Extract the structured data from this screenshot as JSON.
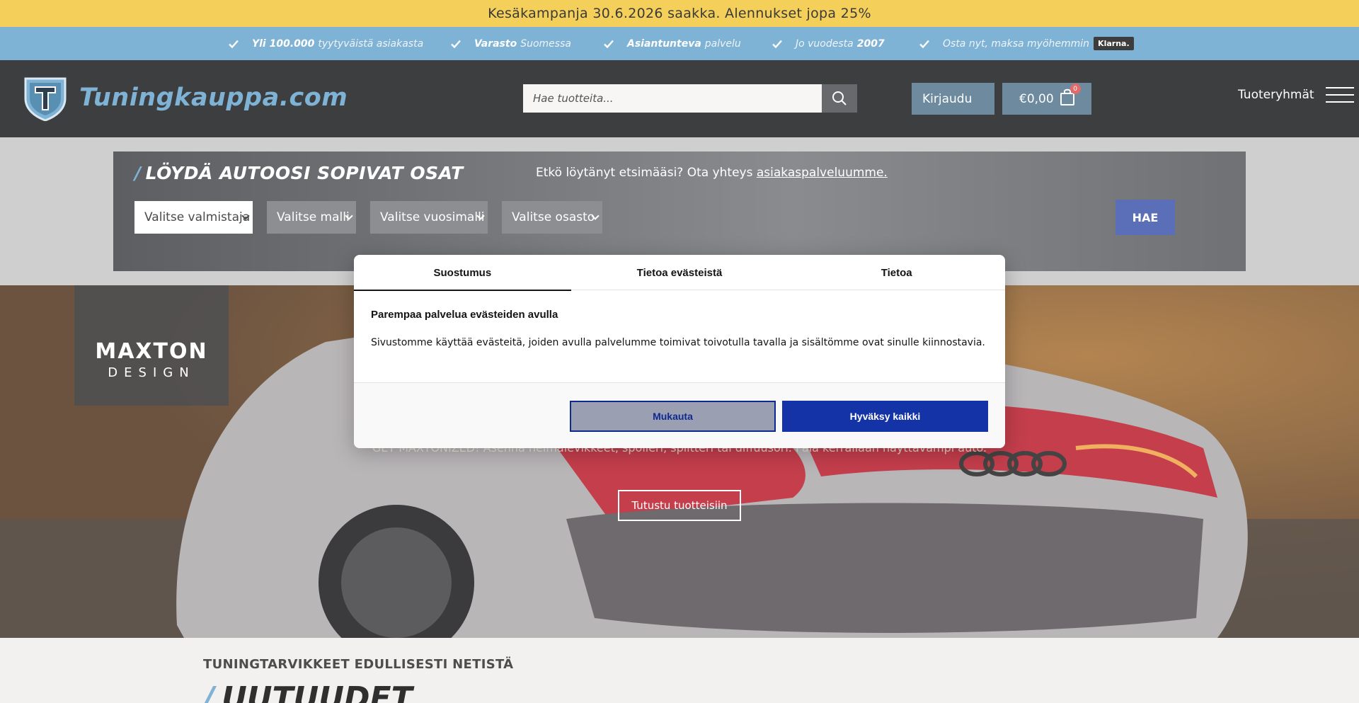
{
  "promo": {
    "text": "Kesäkampanja 30.6.2026 saakka. Alennukset jopa 25%"
  },
  "usp": {
    "items": [
      {
        "strong": "Yli 100.000",
        "light": "tyytyväistä asiakasta"
      },
      {
        "strong": "Varasto",
        "light": "Suomessa"
      },
      {
        "strong": "Asiantunteva",
        "light": "palvelu"
      },
      {
        "light": "Jo vuodesta",
        "strong": "2007"
      },
      {
        "light": "Osta nyt, maksa myöhemmin",
        "badge": "Klarna."
      }
    ]
  },
  "header": {
    "logo_text": "Tuningkauppa.com",
    "search_placeholder": "Hae tuotteita...",
    "login_label": "Kirjaudu",
    "cart_total": "€0,00",
    "cart_count": "0",
    "categories_label": "Tuoteryhmät"
  },
  "finder": {
    "title": "LÖYDÄ AUTOOSI SOPIVAT OSAT",
    "help_text": "Etkö löytänyt etsimääsi? Ota yhteys",
    "help_link": "asiakaspalveluumme.",
    "selects": [
      "Valitse valmistaja",
      "Valitse malli",
      "Valitse vuosimalli",
      "Valitse osasto"
    ],
    "search_button": "HAE"
  },
  "hero": {
    "brand_line1": "MAXTON",
    "brand_line2": "DESIGN",
    "subtitle": "GET MAXTONIZED! Asenna helmalevikkeet, spoileri, splitteri tai diffuusori. Pala kerrallaan näyttävämpi auto.",
    "cta": "Tutustu tuotteisiin"
  },
  "lower": {
    "kicker": "TUNINGTARVIKKEET EDULLISESTI NETISTÄ",
    "title": "UUTUUDET"
  },
  "cookie_dialog": {
    "tabs": [
      "Suostumus",
      "Tietoa evästeistä",
      "Tietoa"
    ],
    "active_tab": 0,
    "heading": "Parempaa palvelua evästeiden avulla",
    "body": "Sivustomme käyttää evästeitä, joiden avulla palvelumme toimivat toivotulla tavalla ja sisältömme ovat sinulle kiinnostavia.",
    "customize_label": "Mukauta",
    "accept_label": "Hyväksy kaikki"
  },
  "colors": {
    "promo": "#f4d05a",
    "usp": "#7fb3d5",
    "header": "#3d3e40",
    "accent_blue": "#1433a6",
    "hae": "#5a6fb7"
  },
  "icons": [
    "check-icon",
    "search-icon",
    "cart-icon",
    "menu-icon",
    "logo-shield-icon"
  ]
}
